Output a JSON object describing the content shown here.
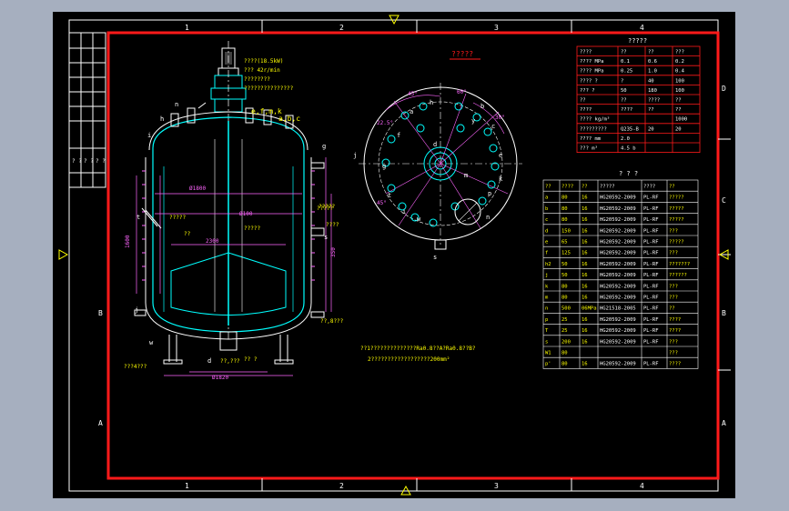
{
  "colors": {
    "frame": "#ff1a1a",
    "outline": "#ffffff",
    "vessel": "#00ffff",
    "dim": "#ff66ff",
    "text": "#ffff00",
    "green": "#00ff66",
    "bg": "#000000",
    "window": "#a6afbf"
  },
  "zone_labels": {
    "top": [
      "1",
      "2",
      "3",
      "4"
    ],
    "bottom": [
      "1",
      "2",
      "3",
      "4"
    ],
    "right": [
      "D",
      "C",
      "B",
      "A"
    ],
    "left": [
      "B",
      "A"
    ]
  },
  "title_block": {
    "items": [
      "? ?",
      "? ?",
      "? ?"
    ]
  },
  "elevation": {
    "motor_labels": [
      "????(18.5kW)",
      "???   42r/min",
      "????????",
      "???????????????"
    ],
    "nozzle_group_a": "e,f,m,k",
    "nozzle_group_b": "a,b,c",
    "labels": [
      "?????",
      "??",
      "?????",
      "?????",
      "????",
      "??,8???",
      "???4???",
      "?????",
      "?? ?",
      "??,???"
    ],
    "dims": [
      "Ø1800",
      "Ø100",
      "2300",
      "1600",
      "Ø1820",
      "350"
    ],
    "refs": [
      "h",
      "j",
      "t",
      "s",
      "d",
      "i",
      "g",
      "n",
      "w"
    ]
  },
  "plan": {
    "title": "?????",
    "refs": [
      "a",
      "b",
      "c",
      "d",
      "e",
      "f",
      "g",
      "h",
      "i",
      "j",
      "k",
      "m",
      "n",
      "p",
      "s",
      "t",
      "w",
      "y"
    ],
    "angles": [
      "45°",
      "60°",
      "30°",
      "22.5°",
      "45°"
    ]
  },
  "tech_table": {
    "title": "?????",
    "headers": [
      "????",
      "??",
      "??",
      "???"
    ],
    "rows": [
      [
        "???? MPa",
        "0.1",
        "0.6",
        "0.2"
      ],
      [
        "???? MPa",
        "0.25",
        "1.0",
        "0.4"
      ],
      [
        "???? ?",
        "?",
        "40",
        "100"
      ],
      [
        "??? ?",
        "50",
        "180",
        "100"
      ],
      [
        "??",
        "??",
        "????",
        "??"
      ],
      [
        "????",
        "????",
        "??",
        "??"
      ],
      [
        "???? kg/m³",
        "",
        "",
        "1000"
      ],
      [
        "?????????",
        "Q235-B",
        "20",
        "20"
      ],
      [
        "???? mm",
        "2.0",
        "",
        ""
      ],
      [
        "??? m³",
        "4.5 b",
        "",
        ""
      ]
    ]
  },
  "nozzle_table": {
    "title": "? ? ?",
    "headers": [
      "??",
      "????",
      "??",
      "?????",
      "????",
      "??"
    ],
    "rows": [
      [
        "a",
        "80",
        "16",
        "HG20592-2009",
        "PL-RF",
        "?????"
      ],
      [
        "b",
        "80",
        "16",
        "HG20592-2009",
        "PL-RF",
        "?????"
      ],
      [
        "c",
        "80",
        "16",
        "HG20592-2009",
        "PL-RF",
        "?????"
      ],
      [
        "d",
        "150",
        "16",
        "HG20592-2009",
        "PL-RF",
        "???"
      ],
      [
        "e",
        "65",
        "16",
        "HG20592-2009",
        "PL-RF",
        "?????"
      ],
      [
        "f",
        "125",
        "16",
        "HG20592-2009",
        "PL-RF",
        "???"
      ],
      [
        "h2",
        "50",
        "16",
        "HG20592-2009",
        "PL-RF",
        "???????"
      ],
      [
        "j",
        "50",
        "16",
        "HG20592-2009",
        "PL-RF",
        "??????"
      ],
      [
        "k",
        "80",
        "16",
        "HG20592-2009",
        "PL-RF",
        "???"
      ],
      [
        "m",
        "80",
        "16",
        "HG20592-2009",
        "PL-RF",
        "???"
      ],
      [
        "n",
        "500",
        "06MPa",
        "HG21518-2005",
        "PL-RF",
        "??"
      ],
      [
        "p",
        "25",
        "16",
        "HG20592-2009",
        "PL-RF",
        "????"
      ],
      [
        "T",
        "25",
        "16",
        "HG20592-2009",
        "PL-RF",
        "????"
      ],
      [
        "s",
        "200",
        "16",
        "HG20592-2009",
        "PL-RF",
        "???"
      ],
      [
        "W1",
        "80",
        "",
        "",
        "",
        "???"
      ],
      [
        "p'",
        "80",
        "16",
        "HG20592-2009",
        "PL-RF",
        "????"
      ]
    ]
  },
  "notes": [
    "??1??????????????Ra0.8??A?Ra0.8??B?",
    "2??????????????????200mm²"
  ]
}
